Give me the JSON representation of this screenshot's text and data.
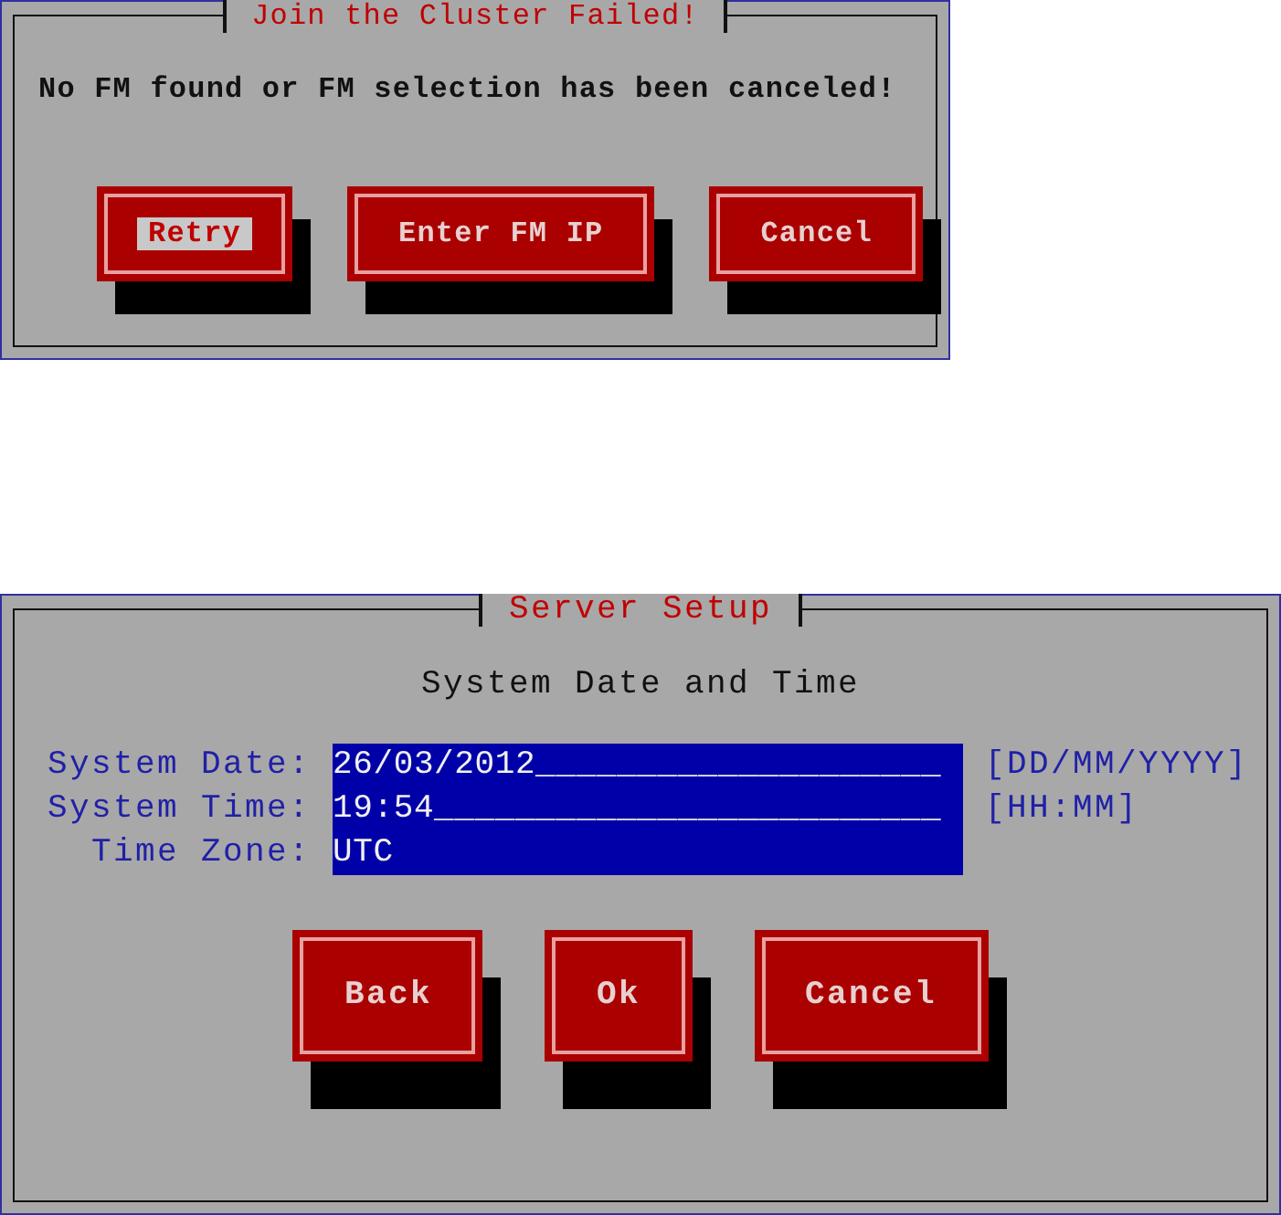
{
  "dialogs": [
    {
      "title": "Join the Cluster Failed!",
      "message": "No FM found or FM selection has been canceled!",
      "buttons": [
        {
          "label": "Retry",
          "selected": true
        },
        {
          "label": "Enter FM IP",
          "selected": false
        },
        {
          "label": "Cancel",
          "selected": false
        }
      ]
    },
    {
      "title": "Server Setup",
      "heading": "System Date and Time",
      "fields": [
        {
          "label": "System Date:",
          "value": "26/03/2012____________________",
          "hint": "[DD/MM/YYYY]"
        },
        {
          "label": "System Time:",
          "value": "19:54_________________________",
          "hint": "[HH:MM]"
        },
        {
          "label": "Time Zone:",
          "value": "UTC"
        }
      ],
      "buttons": [
        {
          "label": "Back",
          "selected": false
        },
        {
          "label": "Ok",
          "selected": false
        },
        {
          "label": "Cancel",
          "selected": false
        }
      ]
    }
  ]
}
